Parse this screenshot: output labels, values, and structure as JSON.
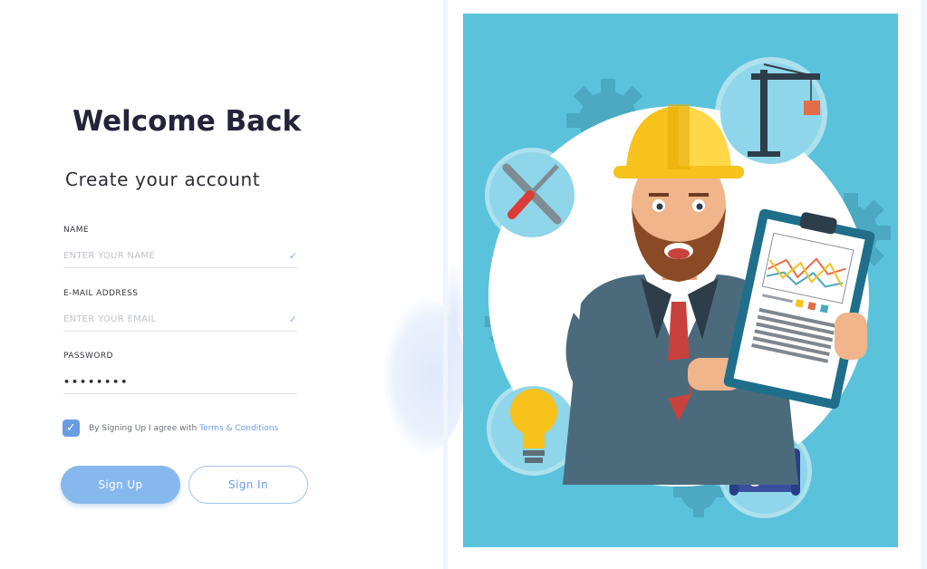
{
  "heading": "Welcome Back",
  "form": {
    "title": "Create your account",
    "name_label": "NAME",
    "name_placeholder": "ENTER YOUR NAME",
    "email_label": "E-MAIL ADDRESS",
    "email_placeholder": "ENTER YOUR EMAIL",
    "password_label": "PASSWORD",
    "password_value": "••••••••",
    "agree_text": "By Signing Up I agree with",
    "terms_link": "Terms & Conditions",
    "signup_label": "Sign Up",
    "signin_label": "Sign In"
  },
  "icons": {
    "field_check": "check-icon",
    "checkbox": "checkbox-checked-icon",
    "illustration": "engineer-illustration",
    "crane": "crane-icon",
    "tools": "wrench-screwdriver-icon",
    "bulb": "lightbulb-icon",
    "blueprint": "blueprint-icon",
    "gear": "gear-icon",
    "clipboard": "clipboard-chart-icon"
  },
  "colors": {
    "accent": "#6a9de0",
    "button_fill": "#87b8ed",
    "illustration_bg": "#5bc2dc",
    "helmet": "#f6c21b",
    "tie": "#c8413c"
  }
}
